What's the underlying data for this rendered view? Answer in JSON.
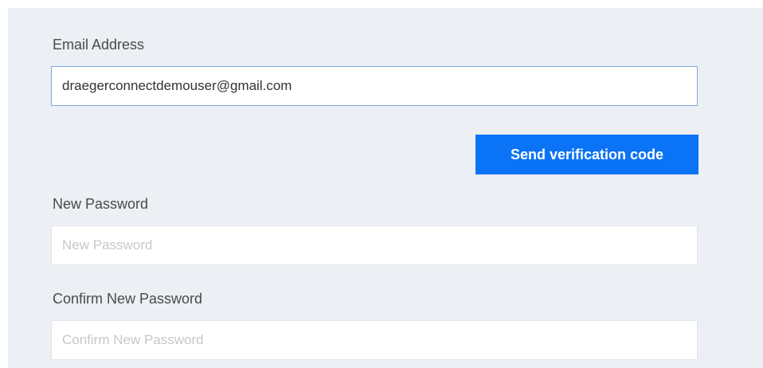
{
  "form": {
    "email_label": "Email Address",
    "email_value": "draegerconnectdemouser@gmail.com",
    "send_button_label": "Send verification code",
    "new_password_label": "New Password",
    "new_password_placeholder": "New Password",
    "confirm_password_label": "Confirm New Password",
    "confirm_password_placeholder": "Confirm New Password"
  },
  "colors": {
    "panel_background": "#eceff3",
    "button_background": "#0b73f5",
    "focused_border": "#7fa6e0"
  }
}
